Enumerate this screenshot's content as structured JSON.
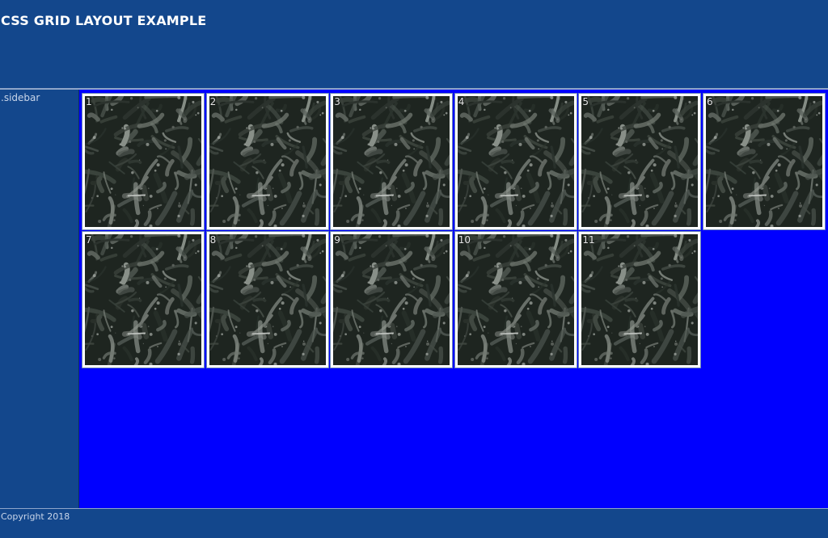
{
  "header": {
    "title": "CSS GRID LAYOUT EXAMPLE"
  },
  "sidebar": {
    "label": ".sidebar"
  },
  "main": {
    "tiles": [
      {
        "number": "1"
      },
      {
        "number": "2"
      },
      {
        "number": "3"
      },
      {
        "number": "4"
      },
      {
        "number": "5"
      },
      {
        "number": "6"
      },
      {
        "number": "7"
      },
      {
        "number": "8"
      },
      {
        "number": "9"
      },
      {
        "number": "10"
      },
      {
        "number": "11"
      }
    ],
    "tile_image": "plant-foliage-image"
  },
  "footer": {
    "copyright": "Copyright 2018"
  },
  "colors": {
    "header_bg": "#13478c",
    "main_bg": "#0000ff",
    "tile_border": "#ffffff",
    "text_light": "#c9d6ea"
  }
}
